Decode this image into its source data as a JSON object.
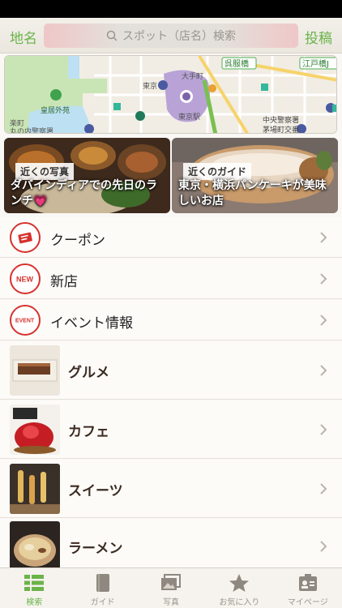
{
  "nav": {
    "left_label": "地名",
    "search_placeholder": "スポット（店名）検索",
    "right_label": "投稿"
  },
  "map": {
    "labels": [
      "呉服橋",
      "江戸橋J",
      "東京",
      "皇居外苑",
      "大手町",
      "中央警察署",
      "茅場町交番",
      "東京駅",
      "楽町",
      "丸の内警察署"
    ],
    "accent": "#6bb34a"
  },
  "cards": [
    {
      "tag": "近くの写真",
      "title": "ダバインディアでの先日のランチ💗"
    },
    {
      "tag": "近くのガイド",
      "title": "東京・横浜パンケーキが美味しいお店"
    }
  ],
  "menu": [
    {
      "label": "クーポン",
      "icon": "coupon-icon"
    },
    {
      "label": "新店",
      "icon": "new-badge-icon",
      "badge": "NEW"
    },
    {
      "label": "イベント情報",
      "icon": "event-badge-icon",
      "badge": "EVENT"
    },
    {
      "label": "グルメ",
      "icon": "gourmet-thumbnail"
    },
    {
      "label": "カフェ",
      "icon": "cafe-thumbnail"
    },
    {
      "label": "スイーツ",
      "icon": "sweets-thumbnail"
    },
    {
      "label": "ラーメン",
      "icon": "ramen-thumbnail"
    }
  ],
  "tabs": [
    {
      "label": "検索",
      "icon": "list-icon",
      "active": true
    },
    {
      "label": "ガイド",
      "icon": "book-icon"
    },
    {
      "label": "写真",
      "icon": "photo-icon"
    },
    {
      "label": "お気に入り",
      "icon": "star-icon"
    },
    {
      "label": "マイページ",
      "icon": "profile-card-icon"
    }
  ],
  "colors": {
    "accent": "#6bb34a",
    "red": "#d6322e"
  }
}
